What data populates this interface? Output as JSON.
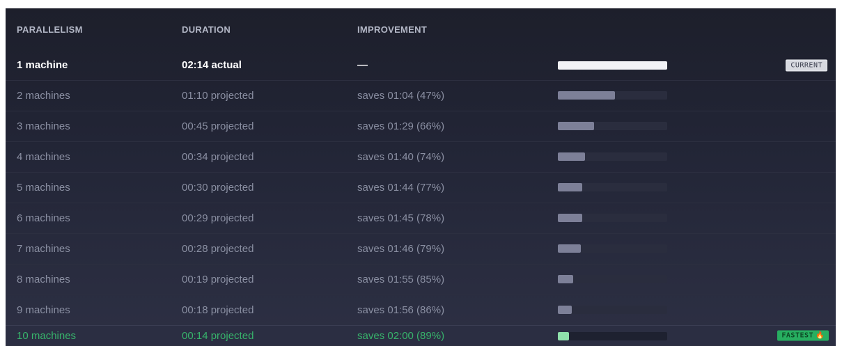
{
  "headers": {
    "parallelism": "PARALLELISM",
    "duration": "DURATION",
    "improvement": "IMPROVEMENT"
  },
  "rows": [
    {
      "parallelism": "1 machine",
      "duration": "02:14 actual",
      "improvement": "—",
      "bar_fraction": 1.0,
      "badge": "CURRENT"
    },
    {
      "parallelism": "2 machines",
      "duration": "01:10 projected",
      "improvement": "saves 01:04 (47%)",
      "bar_fraction": 0.52
    },
    {
      "parallelism": "3 machines",
      "duration": "00:45 projected",
      "improvement": "saves 01:29 (66%)",
      "bar_fraction": 0.33
    },
    {
      "parallelism": "4 machines",
      "duration": "00:34 projected",
      "improvement": "saves 01:40 (74%)",
      "bar_fraction": 0.25
    },
    {
      "parallelism": "5 machines",
      "duration": "00:30 projected",
      "improvement": "saves 01:44 (77%)",
      "bar_fraction": 0.22
    },
    {
      "parallelism": "6 machines",
      "duration": "00:29 projected",
      "improvement": "saves 01:45 (78%)",
      "bar_fraction": 0.22
    },
    {
      "parallelism": "7 machines",
      "duration": "00:28 projected",
      "improvement": "saves 01:46 (79%)",
      "bar_fraction": 0.21
    },
    {
      "parallelism": "8 machines",
      "duration": "00:19 projected",
      "improvement": "saves 01:55 (85%)",
      "bar_fraction": 0.14
    },
    {
      "parallelism": "9 machines",
      "duration": "00:18 projected",
      "improvement": "saves 01:56 (86%)",
      "bar_fraction": 0.13
    },
    {
      "parallelism": "10 machines",
      "duration": "00:14 projected",
      "improvement": "saves 02:00 (89%)",
      "bar_fraction": 0.1,
      "badge": "FASTEST"
    }
  ],
  "colors": {
    "current_bar": "#f1f2f6",
    "projected_bar": "#7d8098",
    "fastest_text": "#37b36b",
    "fastest_badge": "#27ae60"
  },
  "icons": {
    "fastest_badge_icon": "flame-icon"
  }
}
